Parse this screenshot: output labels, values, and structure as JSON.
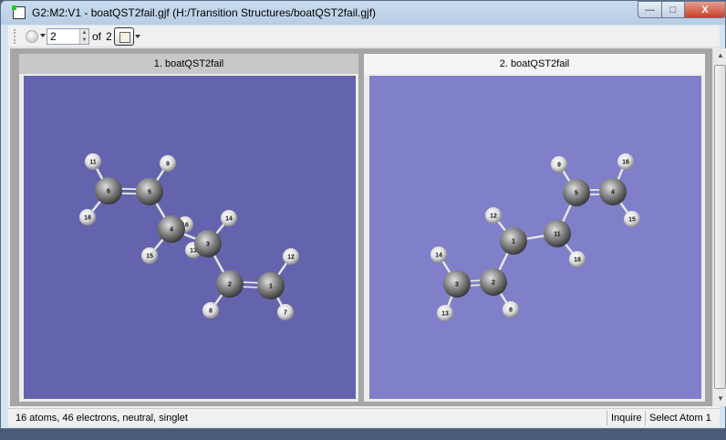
{
  "window": {
    "title": "G2:M2:V1 - boatQST2fail.gjf (H:/Transition Structures/boatQST2fail.gjf)",
    "min": "—",
    "max": "□",
    "close": "X"
  },
  "toolbar": {
    "frame_value": "2",
    "of_label": "of",
    "frame_total": "2"
  },
  "panels": [
    {
      "title": "1.  boatQST2fail",
      "background": "#6464ae",
      "atoms": [
        "6",
        "5",
        "11",
        "9",
        "18",
        "4",
        "16",
        "3",
        "13",
        "14",
        "15",
        "2",
        "1",
        "12",
        "8",
        "7"
      ]
    },
    {
      "title": "2.  boatQST2fail",
      "background": "#8080ca",
      "atoms": [
        "9",
        "16",
        "5",
        "4",
        "15",
        "12",
        "11",
        "1",
        "18",
        "14",
        "3",
        "2",
        "13",
        "8"
      ]
    }
  ],
  "status": {
    "text": "16 atoms, 46 electrons, neutral, singlet",
    "mode": "Inquire",
    "action": "Select Atom 1"
  }
}
